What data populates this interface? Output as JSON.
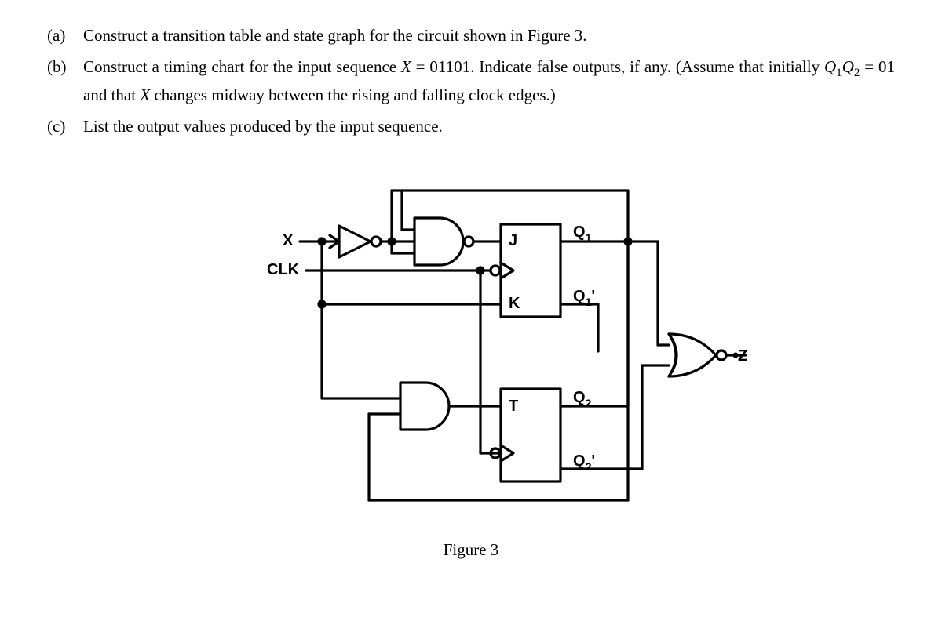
{
  "problem": {
    "a": {
      "letter": "(a)",
      "text": "Construct a transition table and state graph for the circuit shown in Figure 3."
    },
    "b": {
      "letter": "(b)",
      "text1": "Construct a timing chart for the input sequence ",
      "seqvar": "X",
      "eq1": " = 01101.  Indicate false outputs, if any.  (Assume that initially ",
      "qvar": "Q",
      "sub1": "1",
      "sub2": "2",
      "eq2": " = 01 and that ",
      "xvar": "X",
      "tail": " changes midway between the rising and falling clock edges.)"
    },
    "c": {
      "letter": "(c)",
      "text": "List the output values produced by the input sequence."
    }
  },
  "labels": {
    "X": "X",
    "CLK": "CLK",
    "J": "J",
    "K": "K",
    "T": "T",
    "Q1": "Q",
    "Q1sub": "1",
    "Q1p": "Q",
    "Q1psub": "1",
    "Q1ptick": "'",
    "Q2": "Q",
    "Q2sub": "2",
    "Q2p": "Q",
    "Q2psub": "2",
    "Q2ptick": "'",
    "Z": "Z"
  },
  "figure_caption": "Figure 3",
  "chart_data": {
    "type": "diagram",
    "circuit": {
      "inputs": [
        "X",
        "CLK"
      ],
      "gates": [
        {
          "id": "NOT1",
          "type": "NOT",
          "inputs": [
            "X"
          ],
          "output": "Xbar"
        },
        {
          "id": "NAND1",
          "type": "NAND",
          "inputs": [
            "Xbar",
            "Q2"
          ],
          "output": "J"
        },
        {
          "id": "AND1",
          "type": "AND",
          "inputs": [
            "X",
            "Q1"
          ],
          "output": "T"
        },
        {
          "id": "NOR1",
          "type": "NOR",
          "inputs": [
            "Q1",
            "Q2p"
          ],
          "output": "Z"
        }
      ],
      "flipflops": [
        {
          "id": "FF1",
          "type": "JK",
          "J": "J",
          "K": "X",
          "CLK": "CLK_bar",
          "Q": "Q1",
          "Qbar": "Q1p"
        },
        {
          "id": "FF2",
          "type": "T",
          "T": "T",
          "CLK": "CLK_bar",
          "Q": "Q2",
          "Qbar": "Q2p"
        }
      ],
      "outputs": [
        "Z"
      ]
    }
  }
}
